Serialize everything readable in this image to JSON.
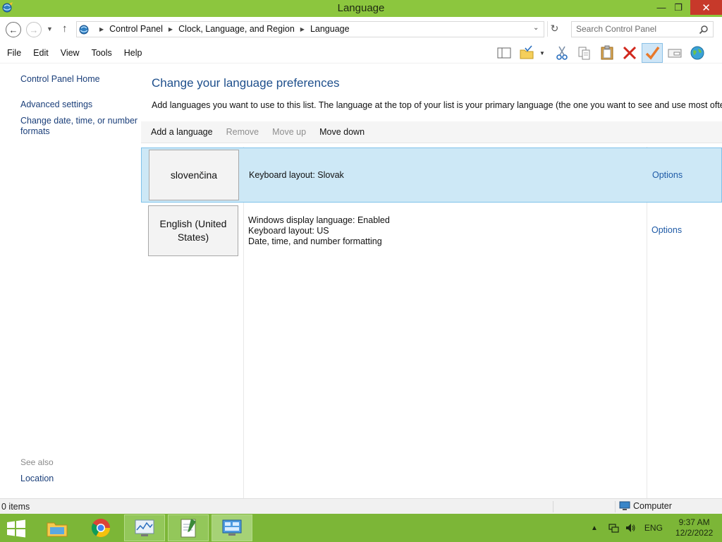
{
  "window": {
    "title": "Language"
  },
  "address": {
    "crumbs": [
      "Control Panel",
      "Clock, Language, and Region",
      "Language"
    ],
    "search_placeholder": "Search Control Panel"
  },
  "menu": {
    "items": [
      "File",
      "Edit",
      "View",
      "Tools",
      "Help"
    ]
  },
  "toolbar": {
    "icons": [
      "layout-pane-icon",
      "folder-check-icon",
      "cut-icon",
      "copy-icon",
      "paste-icon",
      "delete-icon",
      "checkmark-icon",
      "properties-icon",
      "globe-icon"
    ]
  },
  "sidebar": {
    "home": "Control Panel Home",
    "advanced": "Advanced settings",
    "date_formats": "Change date, time, or number formats",
    "see_also": "See also",
    "location": "Location"
  },
  "main": {
    "title": "Change your language preferences",
    "description": "Add languages you want to use to this list. The language at the top of your list is your primary language (the one you want to see and use most often).",
    "actions": {
      "add": "Add a language",
      "remove": "Remove",
      "move_up": "Move up",
      "move_down": "Move down"
    },
    "languages": [
      {
        "name": "slovenčina",
        "details": [
          "Keyboard layout: Slovak"
        ],
        "options": "Options",
        "selected": true
      },
      {
        "name": "English (United States)",
        "details": [
          "Windows display language: Enabled",
          "Keyboard layout: US",
          "Date, time, and number formatting"
        ],
        "options": "Options",
        "selected": false
      }
    ]
  },
  "status": {
    "items": "0 items",
    "location": "Computer"
  },
  "taskbar": {
    "input_language": "ENG",
    "time": "9:37 AM",
    "date": "12/2/2022"
  },
  "colors": {
    "titlebar": "#8cc63e",
    "taskbar": "#7cb637",
    "selection": "#cde8f6",
    "link": "#1e5aa6"
  }
}
